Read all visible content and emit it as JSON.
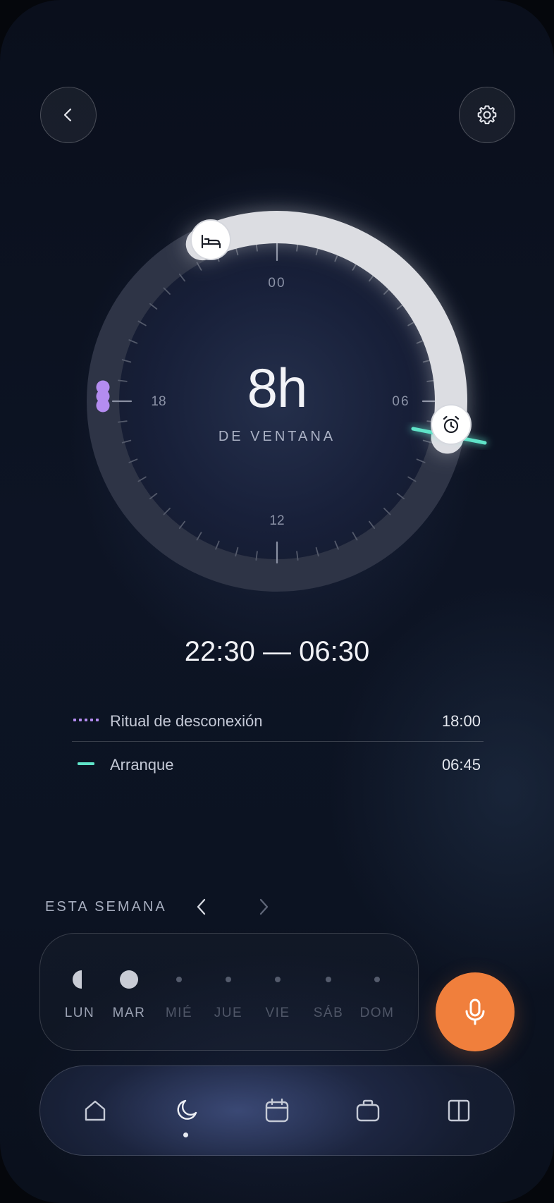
{
  "header": {
    "back_icon": "chevron-left-icon",
    "settings_icon": "gear-icon"
  },
  "dial": {
    "hour_labels": {
      "top": "00",
      "right": "06",
      "bottom": "12",
      "left": "18"
    },
    "window_hours": "8h",
    "window_label": "DE VENTANA",
    "bedtime_icon": "bed-icon",
    "wake_icon": "alarm-clock-icon",
    "accent_purple": "#b48cf0",
    "accent_teal": "#5fe3c8",
    "arc_color": "#dcdde2"
  },
  "schedule": {
    "range": "22:30 — 06:30"
  },
  "routines": [
    {
      "label": "Ritual de desconexión",
      "time": "18:00",
      "indicator": "dotted-purple-line",
      "color": "#b48cf0"
    },
    {
      "label": "Arranque",
      "time": "06:45",
      "indicator": "teal-line",
      "color": "#5fe3c8"
    }
  ],
  "week": {
    "title": "ESTA SEMANA",
    "prev_icon": "chevron-left-icon",
    "next_icon": "chevron-right-icon",
    "days": [
      {
        "name": "LUN",
        "state": "half"
      },
      {
        "name": "MAR",
        "state": "full"
      },
      {
        "name": "MIÉ",
        "state": "empty"
      },
      {
        "name": "JUE",
        "state": "empty"
      },
      {
        "name": "VIE",
        "state": "empty"
      },
      {
        "name": "SÁB",
        "state": "empty"
      },
      {
        "name": "DOM",
        "state": "empty"
      }
    ]
  },
  "mic": {
    "icon": "microphone-icon",
    "color": "#f07f3c"
  },
  "tabbar": {
    "tabs": [
      {
        "icon": "home-icon",
        "active": false
      },
      {
        "icon": "moon-icon",
        "active": true
      },
      {
        "icon": "calendar-icon",
        "active": false
      },
      {
        "icon": "briefcase-icon",
        "active": false
      },
      {
        "icon": "columns-icon",
        "active": false
      }
    ]
  }
}
